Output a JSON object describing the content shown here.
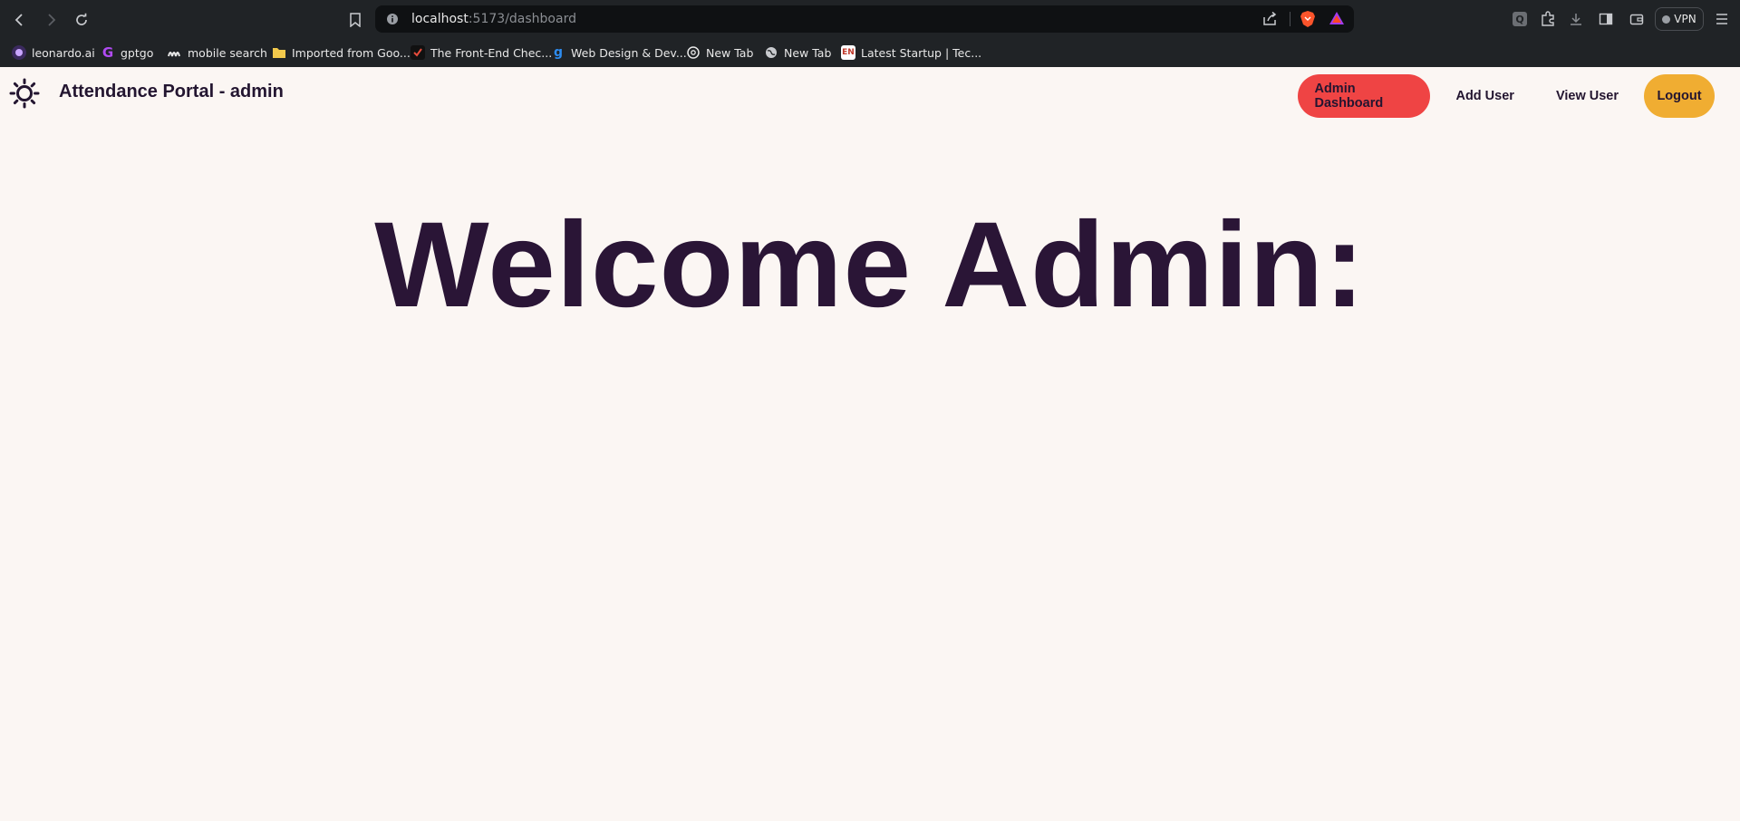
{
  "browser": {
    "url_host": "localhost",
    "url_path": ":5173/dashboard",
    "vpn_label": "VPN",
    "bookmarks": [
      {
        "label": "leonardo.ai",
        "icon": "leonardo-icon"
      },
      {
        "label": "gptgo",
        "icon": "gptgo-icon"
      },
      {
        "label": "mobile search",
        "icon": "mobile-search-icon"
      },
      {
        "label": "Imported from Goo...",
        "icon": "folder-icon"
      },
      {
        "label": "The Front-End Chec...",
        "icon": "checklist-icon"
      },
      {
        "label": "Web Design & Dev...",
        "icon": "webdesign-icon"
      },
      {
        "label": "New Tab",
        "icon": "openai-icon"
      },
      {
        "label": "New Tab",
        "icon": "globe-icon"
      },
      {
        "label": "Latest Startup | Tec...",
        "icon": "en-icon"
      }
    ]
  },
  "app": {
    "brand": "Attendance Portal -  admin",
    "nav": {
      "admin_dashboard": "Admin Dashboard",
      "add_user": "Add User",
      "view_user": "View User",
      "logout": "Logout"
    },
    "welcome": "Welcome Admin:"
  },
  "colors": {
    "background": "#fbf6f3",
    "text": "#231530",
    "active_nav": "#ef4444",
    "logout": "#f0ad32"
  }
}
